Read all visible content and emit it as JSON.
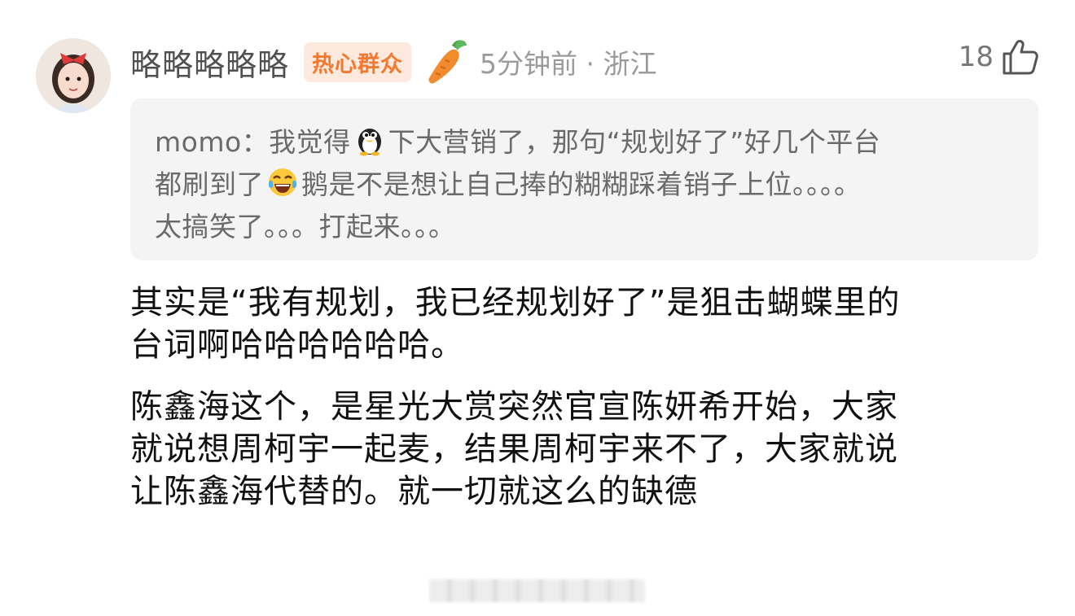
{
  "comment": {
    "username": "略略略略略",
    "badge": "热心群众",
    "time": "5分钟前",
    "separator": "·",
    "location": "浙江",
    "likes": "18",
    "avatar_icon": "avatar-girl-red-bow",
    "badge_icon": "carrot-icon",
    "like_icon": "thumbs-up-icon"
  },
  "quote": {
    "author": "momo",
    "colon": "：",
    "part1": "我觉得",
    "emoji1": "penguin",
    "part2": "下大营销了，那句“规划好了”好几个平台",
    "part3": "都刷到了",
    "emoji2": "tears-of-joy",
    "part4": "鹅是不是想让自己捧的糊糊踩着销子上位。。。。",
    "part5": "太搞笑了。。。打起来。。。"
  },
  "content": {
    "para1_line1": "其实是“我有规划，我已经规划好了”是狙击蝴蝶里的",
    "para1_line2": "台词啊哈哈哈哈哈哈。",
    "para2_line1": "陈鑫海这个，是星光大赏突然官宣陈妍希开始，大家",
    "para2_line2": "就说想周柯宇一起麦，结果周柯宇来不了，大家就说",
    "para2_line3": "让陈鑫海代替的。就一切就这么的缺德"
  },
  "colors": {
    "badge_bg": "#fde9de",
    "badge_text": "#f2792f",
    "quote_bg": "#f4f4f4",
    "meta_text": "#9a9a9a"
  }
}
